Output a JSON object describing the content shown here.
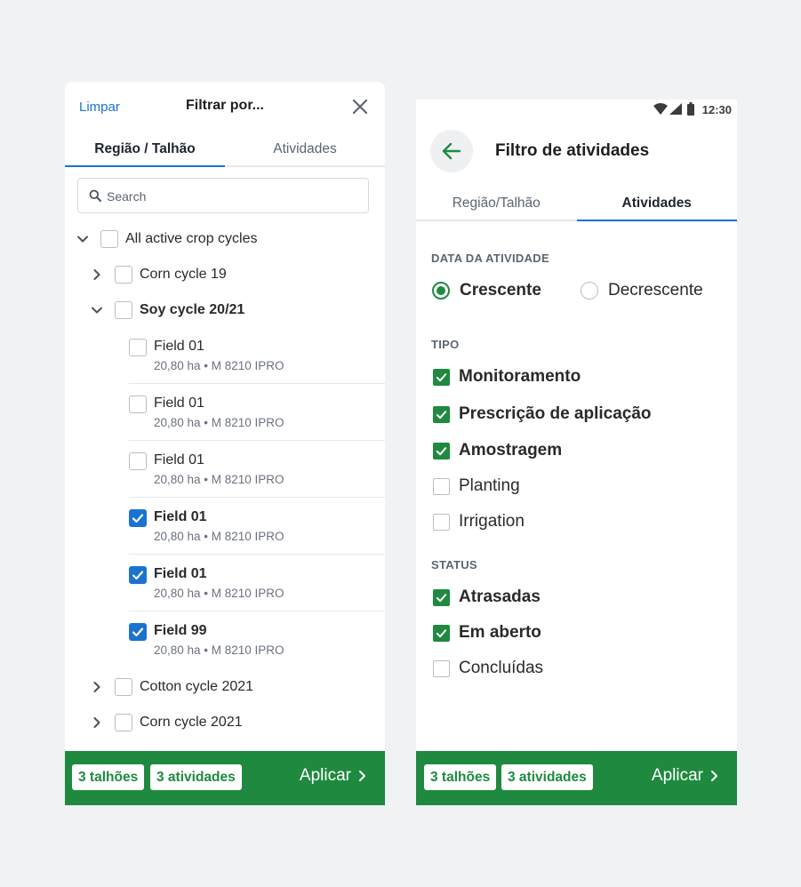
{
  "left": {
    "clear_label": "Limpar",
    "title": "Filtrar por...",
    "tabs": [
      {
        "label": "Região / Talhão",
        "active": true
      },
      {
        "label": "Atividades",
        "active": false
      }
    ],
    "search_placeholder": "Search",
    "tree": {
      "root": {
        "label": "All active crop cycles",
        "checked": false,
        "expanded": true
      },
      "groups": [
        {
          "label": "Corn cycle 19",
          "checked": false,
          "expanded": false
        },
        {
          "label": "Soy cycle 20/21",
          "checked": false,
          "expanded": true
        },
        {
          "label": "Cotton cycle 2021",
          "checked": false,
          "expanded": false
        },
        {
          "label": "Corn cycle 2021",
          "checked": false,
          "expanded": false
        }
      ],
      "fields": [
        {
          "name": "Field 01",
          "detail": "20,80 ha • M 8210 IPRO",
          "checked": false
        },
        {
          "name": "Field 01",
          "detail": "20,80 ha • M 8210 IPRO",
          "checked": false
        },
        {
          "name": "Field 01",
          "detail": "20,80 ha • M 8210 IPRO",
          "checked": false
        },
        {
          "name": "Field 01",
          "detail": "20,80 ha • M 8210 IPRO",
          "checked": true
        },
        {
          "name": "Field 01",
          "detail": "20,80 ha • M 8210 IPRO",
          "checked": true
        },
        {
          "name": "Field 99",
          "detail": "20,80 ha • M 8210 IPRO",
          "checked": true
        }
      ]
    },
    "footer": {
      "chip_fields": "3 talhões",
      "chip_activities": "3 atividades",
      "apply_label": "Aplicar"
    }
  },
  "right": {
    "status_time": "12:30",
    "title": "Filtro de atividades",
    "tabs": [
      {
        "label": "Região/Talhão",
        "active": false
      },
      {
        "label": "Atividades",
        "active": true
      }
    ],
    "date_section": {
      "heading": "DATA DA ATIVIDADE",
      "options": [
        {
          "label": "Crescente",
          "selected": true
        },
        {
          "label": "Decrescente",
          "selected": false
        }
      ]
    },
    "type_section": {
      "heading": "TIPO",
      "items": [
        {
          "label": "Monitoramento",
          "checked": true
        },
        {
          "label": "Prescrição de aplicação",
          "checked": true
        },
        {
          "label": "Amostragem",
          "checked": true
        },
        {
          "label": "Planting",
          "checked": false
        },
        {
          "label": "Irrigation",
          "checked": false
        }
      ]
    },
    "status_section": {
      "heading": "STATUS",
      "items": [
        {
          "label": "Atrasadas",
          "checked": true
        },
        {
          "label": "Em aberto",
          "checked": true
        },
        {
          "label": "Concluídas",
          "checked": false
        }
      ]
    },
    "footer": {
      "chip_fields": "3 talhões",
      "chip_activities": "3 atividades",
      "apply_label": "Aplicar"
    }
  },
  "colors": {
    "blue": "#1a73d1",
    "green": "#1f8a3f"
  }
}
